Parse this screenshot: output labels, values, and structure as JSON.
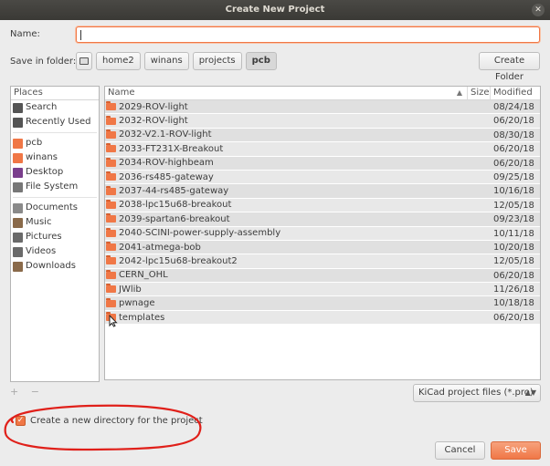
{
  "window": {
    "title": "Create New Project",
    "close_glyph": "✕"
  },
  "name_field": {
    "label": "Name:",
    "value": ""
  },
  "save_in": {
    "label": "Save in folder:",
    "breadcrumbs": [
      "home2",
      "winans",
      "projects",
      "pcb"
    ]
  },
  "create_folder_label": "Create Folder",
  "places": {
    "header": "Places",
    "items": [
      {
        "label": "Search",
        "icon": "search-icon",
        "color": "#555555"
      },
      {
        "label": "Recently Used",
        "icon": "clock-icon",
        "color": "#555555"
      },
      {
        "label": "pcb",
        "icon": "folder-icon",
        "color": "#f07746"
      },
      {
        "label": "winans",
        "icon": "home-folder-icon",
        "color": "#f07746"
      },
      {
        "label": "Desktop",
        "icon": "desktop-icon",
        "color": "#7a3e8c"
      },
      {
        "label": "File System",
        "icon": "drive-icon",
        "color": "#777777"
      },
      {
        "label": "Documents",
        "icon": "documents-icon",
        "color": "#8a8a8a"
      },
      {
        "label": "Music",
        "icon": "music-icon",
        "color": "#8a6a4a"
      },
      {
        "label": "Pictures",
        "icon": "pictures-icon",
        "color": "#6a6a6a"
      },
      {
        "label": "Videos",
        "icon": "videos-icon",
        "color": "#6a6a6a"
      },
      {
        "label": "Downloads",
        "icon": "downloads-icon",
        "color": "#8a6a4a"
      }
    ],
    "add_glyph": "+",
    "remove_glyph": "−"
  },
  "files": {
    "columns": {
      "name": "Name",
      "size": "Size",
      "modified": "Modified"
    },
    "rows": [
      {
        "name": "2029-ROV-light",
        "modified": "08/24/18"
      },
      {
        "name": "2032-ROV-light",
        "modified": "06/20/18"
      },
      {
        "name": "2032-V2.1-ROV-light",
        "modified": "08/30/18"
      },
      {
        "name": "2033-FT231X-Breakout",
        "modified": "06/20/18"
      },
      {
        "name": "2034-ROV-highbeam",
        "modified": "06/20/18"
      },
      {
        "name": "2036-rs485-gateway",
        "modified": "09/25/18"
      },
      {
        "name": "2037-44-rs485-gateway",
        "modified": "10/16/18"
      },
      {
        "name": "2038-lpc15u68-breakout",
        "modified": "12/05/18"
      },
      {
        "name": "2039-spartan6-breakout",
        "modified": "09/23/18"
      },
      {
        "name": "2040-SCINI-power-supply-assembly",
        "modified": "10/11/18"
      },
      {
        "name": "2041-atmega-bob",
        "modified": "10/20/18"
      },
      {
        "name": "2042-lpc15u68-breakout2",
        "modified": "12/05/18"
      },
      {
        "name": "CERN_OHL",
        "modified": "06/20/18"
      },
      {
        "name": "JWlib",
        "modified": "11/26/18"
      },
      {
        "name": "pwnage",
        "modified": "10/18/18"
      },
      {
        "name": "templates",
        "modified": "06/20/18"
      }
    ]
  },
  "filter": {
    "selected": "KiCad project files (*.pro)"
  },
  "checkbox": {
    "label": "Create a new directory for the project",
    "checked": true
  },
  "buttons": {
    "cancel": "Cancel",
    "save": "Save"
  },
  "colors": {
    "accent": "#f07746",
    "annotation": "#e0201a"
  }
}
